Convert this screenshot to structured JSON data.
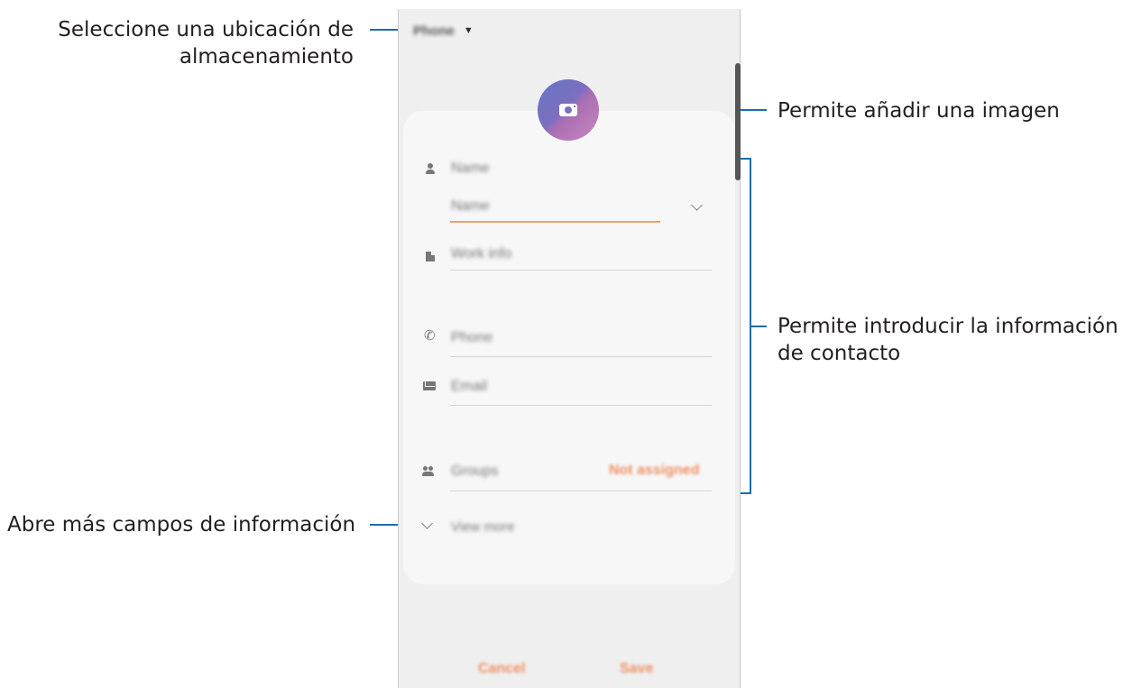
{
  "annotations": {
    "storage_line1": "Seleccione una ubicación de",
    "storage_line2": "almacenamiento",
    "image": "Permite añadir una imagen",
    "contact_line1": "Permite introducir la información",
    "contact_line2": "de contacto",
    "more_fields": "Abre más campos de información"
  },
  "phone": {
    "storage_location": "Phone",
    "fields": {
      "name_label": "Name",
      "name_value": "Name",
      "work": "Work info",
      "phone": "Phone",
      "email": "Email",
      "groups_label": "Groups",
      "groups_value": "Not assigned",
      "view_more": "View more"
    },
    "actions": {
      "cancel": "Cancel",
      "save": "Save"
    }
  },
  "colors": {
    "annotation_line": "#1a6fb0",
    "accent_orange": "#ef8f63",
    "photo_gradient_start": "#6775c9",
    "photo_gradient_end": "#c887c2"
  },
  "icons": [
    "caret-down-icon",
    "camera-icon",
    "person-icon",
    "chevron-down-icon",
    "building-icon",
    "phone-icon",
    "mail-icon",
    "group-icon"
  ]
}
